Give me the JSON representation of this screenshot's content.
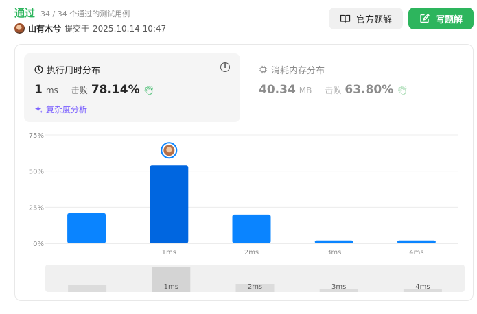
{
  "header": {
    "status": "通过",
    "tests": "34 / 34 个通过的测试用例",
    "user_name": "山有木兮",
    "submit_label": "提交于",
    "submit_time": "2025.10.14 10:47",
    "solution_button": "官方题解",
    "write_button": "写题解"
  },
  "runtime": {
    "title": "执行用时分布",
    "value": "1",
    "unit": "ms",
    "beats_label": "击败",
    "beats_value": "78.14%",
    "complexity_link": "复杂度分析"
  },
  "memory": {
    "title": "消耗内存分布",
    "value": "40.34",
    "unit": "MB",
    "beats_label": "击败",
    "beats_value": "63.80%"
  },
  "colors": {
    "accent_green": "#2db55d",
    "bar_blue": "#0a84ff",
    "bar_selected": "#0066e0",
    "complexity_purple": "#7b61ff"
  },
  "chart_data": {
    "type": "bar",
    "categories": [
      "",
      "1ms",
      "2ms",
      "3ms",
      "4ms"
    ],
    "values": [
      21,
      54,
      20,
      2,
      2
    ],
    "selected_index": 1,
    "ylim": [
      0,
      75
    ],
    "yticks": [
      "0%",
      "25%",
      "50%",
      "75%"
    ],
    "ytick_values": [
      0,
      25,
      50,
      75
    ],
    "grid": true,
    "minimap_values": [
      10,
      36,
      12,
      4,
      4
    ],
    "minimap_labels": [
      "",
      "1ms",
      "2ms",
      "3ms",
      "4ms"
    ]
  }
}
